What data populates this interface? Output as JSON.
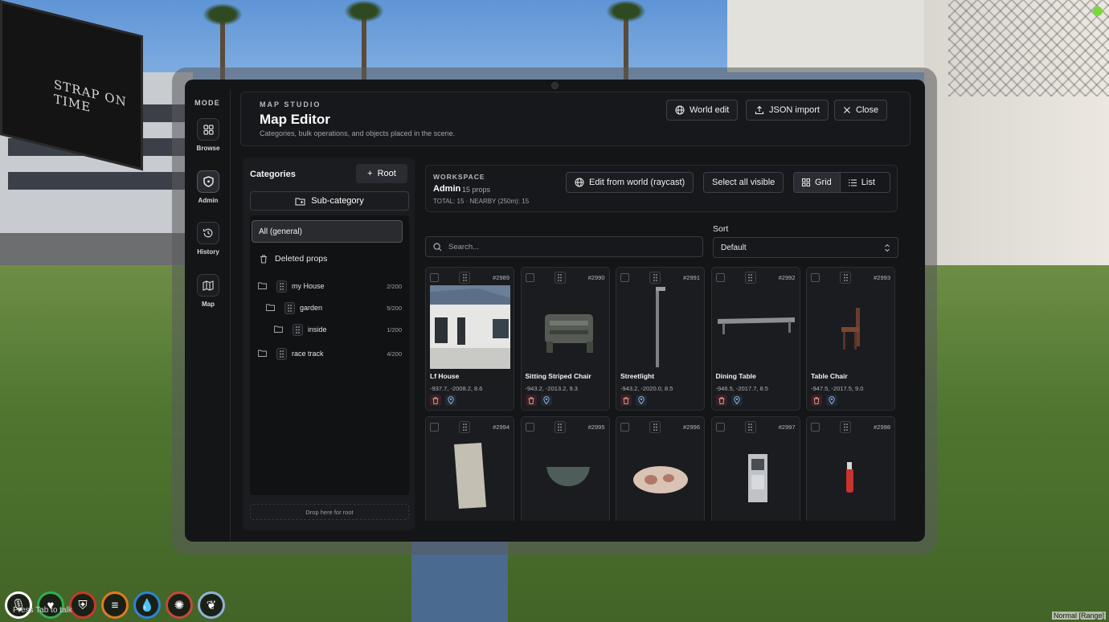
{
  "scene": {
    "billboard_text": "STRAP ON TIME"
  },
  "hud": {
    "icons": [
      "mic-icon",
      "heart-icon",
      "shield-icon",
      "food-icon",
      "water-icon",
      "brain-icon",
      "lungs-icon"
    ],
    "hint": "Press Tab to talk",
    "voice_range": "Normal [Range]"
  },
  "mode": {
    "title": "MODE",
    "items": [
      {
        "label": "Browse",
        "icon": "grid-icon",
        "active": false
      },
      {
        "label": "Admin",
        "icon": "shield-icon",
        "active": true
      },
      {
        "label": "History",
        "icon": "history-icon",
        "active": false
      },
      {
        "label": "Map",
        "icon": "map-icon",
        "active": false
      }
    ]
  },
  "header": {
    "brand": "MAP STUDIO",
    "title": "Map Editor",
    "subtitle": "Categories, bulk operations, and objects placed in the scene.",
    "world_edit": "World edit",
    "json_import": "JSON import",
    "close": "Close"
  },
  "categories": {
    "title": "Categories",
    "root_btn": "Root",
    "sub_btn": "Sub-category",
    "all": "All (general)",
    "deleted": "Deleted props",
    "tree": [
      {
        "name": "my House",
        "count": "2/200",
        "depth": 0
      },
      {
        "name": "garden",
        "count": "5/200",
        "depth": 1
      },
      {
        "name": "inside",
        "count": "1/200",
        "depth": 2
      },
      {
        "name": "race track",
        "count": "4/200",
        "depth": 0
      }
    ],
    "drop_root": "Drop here for root"
  },
  "workspace": {
    "label": "WORKSPACE",
    "name": "Admin",
    "props": "15 props",
    "total": "TOTAL: 15 · NEARBY (250m): 15",
    "edit_world": "Edit from world (raycast)",
    "select_all": "Select all visible",
    "grid": "Grid",
    "list": "List"
  },
  "search": {
    "placeholder": "Search..."
  },
  "sort": {
    "label": "Sort",
    "value": "Default"
  },
  "props": [
    {
      "id": "#2989",
      "name": "Lf House",
      "coords": "-937.7, -2008.2, 8.6",
      "thumb": "house"
    },
    {
      "id": "#2990",
      "name": "Sitting Striped Chair",
      "coords": "-943.2, -2013.2, 9.3",
      "thumb": "chair-striped"
    },
    {
      "id": "#2991",
      "name": "Streetlight",
      "coords": "-943.2, -2020.0, 8.5",
      "thumb": "streetlight"
    },
    {
      "id": "#2992",
      "name": "Dining Table",
      "coords": "-946.5, -2017.7, 8.5",
      "thumb": "table"
    },
    {
      "id": "#2993",
      "name": "Table Chair",
      "coords": "-947.5, -2017.5, 9.0",
      "thumb": "wood-chair"
    },
    {
      "id": "#2994",
      "name": "",
      "coords": "",
      "thumb": "panel"
    },
    {
      "id": "#2995",
      "name": "",
      "coords": "",
      "thumb": "bowl"
    },
    {
      "id": "#2996",
      "name": "",
      "coords": "",
      "thumb": "pillow"
    },
    {
      "id": "#2997",
      "name": "",
      "coords": "",
      "thumb": "machine"
    },
    {
      "id": "#2998",
      "name": "",
      "coords": "",
      "thumb": "extinguisher"
    }
  ]
}
